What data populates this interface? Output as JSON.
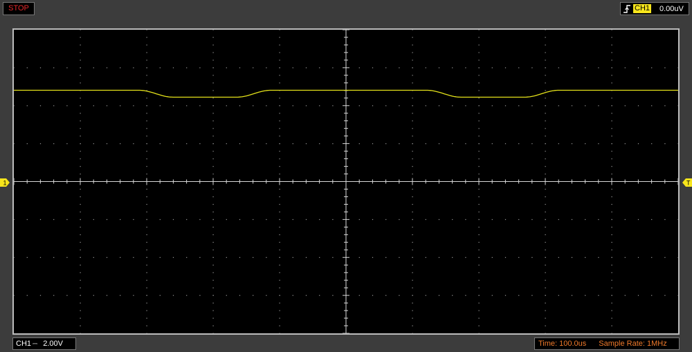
{
  "status": {
    "run_state": "STOP",
    "color": "#e8282b"
  },
  "trigger": {
    "edge_icon": "rising-edge-icon",
    "channel": "CH1",
    "level": "0.00uV",
    "channel_color": "#f7e51c"
  },
  "markers": {
    "channel_marker": "1",
    "trigger_marker": "T"
  },
  "channel": {
    "name": "CH1",
    "coupling_symbol": "⎓",
    "volts_per_div": "2.00V"
  },
  "acquisition": {
    "time_label": "Time: 100.0us",
    "sample_rate_label": "Sample Rate: 1MHz"
  },
  "colors": {
    "trace": "#e6e41a",
    "grid": "#9a9a9a",
    "accent": "#f07a2a",
    "background": "#000000"
  }
}
